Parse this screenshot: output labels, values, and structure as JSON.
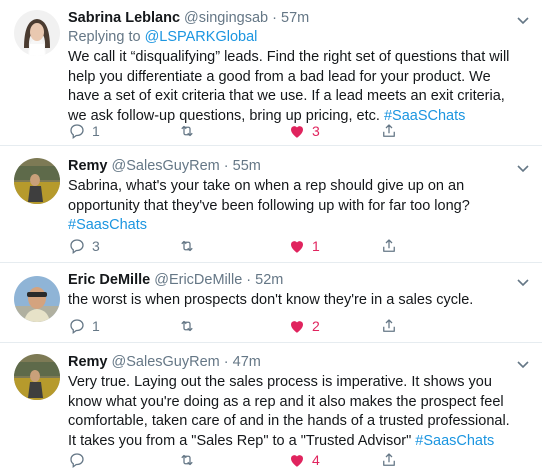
{
  "tweets": [
    {
      "name": "Sabrina Leblanc",
      "handle": "@singingsab",
      "time": "57m",
      "replying_prefix": "Replying to ",
      "replying_to": "@LSPARKGlobal",
      "text": "We call it “disqualifying” leads. Find the right set of questions that will help you differentiate a good from a bad lead for your product. We have a set of exit criteria that we use. If a lead meets an exit criteria, we ask follow-up questions, bring up pricing, etc. ",
      "hashtag": "#SaaSChats",
      "replies": "1",
      "retweets": "",
      "likes": "3"
    },
    {
      "name": "Remy",
      "handle": "@SalesGuyRem",
      "time": "55m",
      "text": "Sabrina, what's your take on when a rep should give up on an opportunity that they've been following up with for far too long? ",
      "hashtag": "#SaasChats",
      "replies": "3",
      "retweets": "",
      "likes": "1"
    },
    {
      "name": "Eric DeMille",
      "handle": "@EricDeMille",
      "time": "52m",
      "text": "the worst is when prospects don't know they're in a sales cycle.",
      "hashtag": "",
      "replies": "1",
      "retweets": "",
      "likes": "2"
    },
    {
      "name": "Remy",
      "handle": "@SalesGuyRem",
      "time": "47m",
      "text": "Very true. Laying out the sales process is imperative. It shows you know what you're doing as a rep and it also makes the prospect feel comfortable, taken care of and in the hands of a trusted professional. It takes you from a \"Sales Rep\" to a \"Trusted Advisor\" ",
      "hashtag": "#SaasChats",
      "replies": "",
      "retweets": "",
      "likes": "4"
    }
  ],
  "separator": " · ",
  "colors": {
    "like": "#e0245e",
    "link": "#1b95e0",
    "muted": "#657786"
  },
  "icons": [
    "chevron-down-icon",
    "reply-icon",
    "retweet-icon",
    "heart-icon",
    "share-icon"
  ]
}
